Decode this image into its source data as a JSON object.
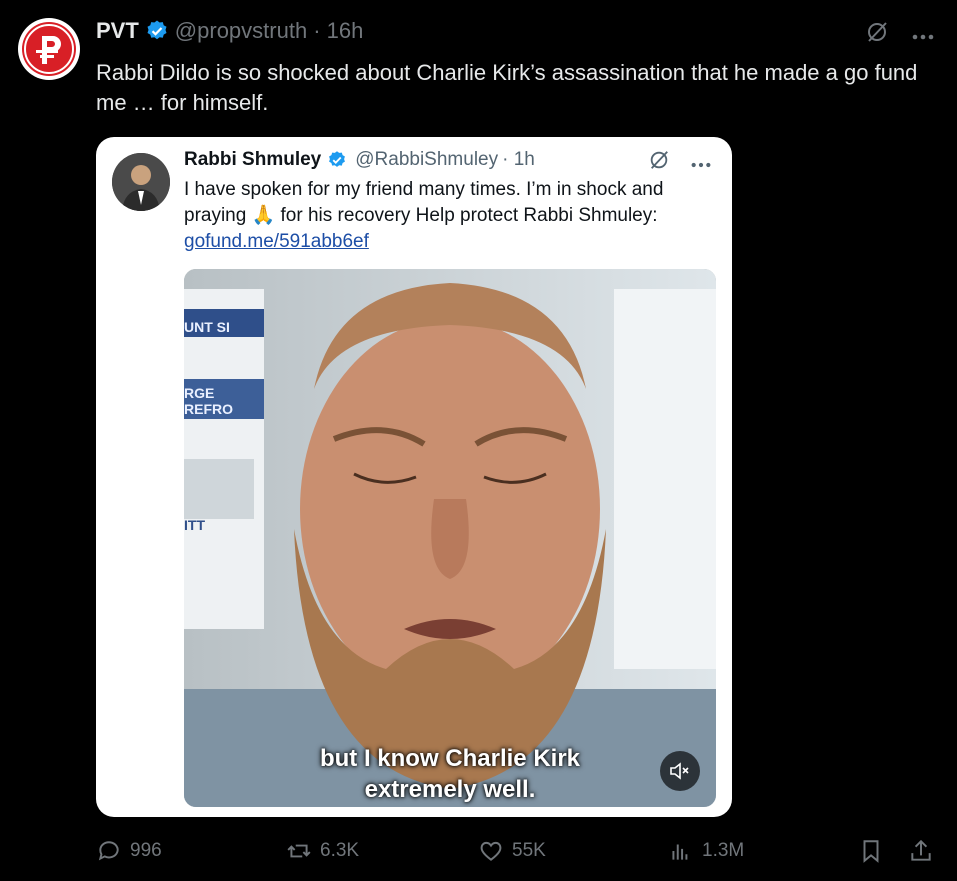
{
  "post": {
    "author_name": "PVT",
    "handle": "@propvstruth",
    "time": "· 16h",
    "text": "Rabbi Dildo is so shocked about Charlie Kirk’s assassination that he made a go fund me … for himself.",
    "avatar_letter": "P"
  },
  "quote": {
    "author_name": "Rabbi Shmuley",
    "handle": "@RabbiShmuley",
    "time": "· 1h",
    "text_before": "I have spoken for my friend many times. I’m in shock and praying 🙏 for his recovery Help protect Rabbi Shmuley:",
    "link": "gofund.me/591abb6ef",
    "video": {
      "caption_line1": "but I know Charlie Kirk",
      "caption_line2": "extremely well.",
      "poster_text": [
        "UNT SI",
        "RGE",
        "REFRO",
        "ITT"
      ]
    }
  },
  "metrics": {
    "replies": "996",
    "reposts": "6.3K",
    "likes": "55K",
    "views": "1.3M"
  },
  "colors": {
    "verified": "#1d9bf0",
    "brand_red": "#d81f26",
    "muted": "#71767b"
  }
}
